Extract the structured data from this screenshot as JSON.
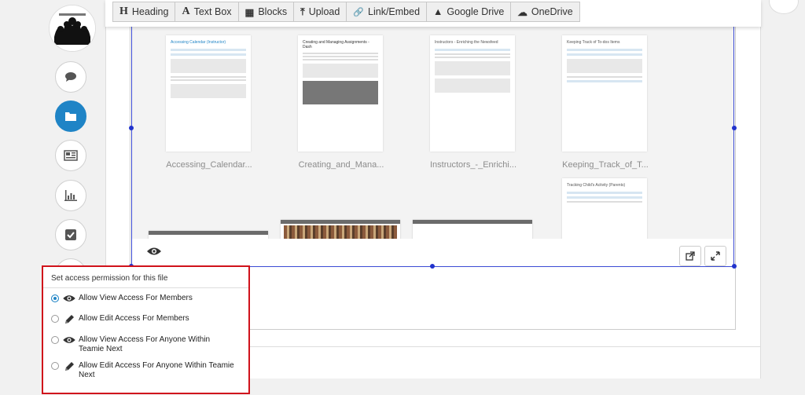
{
  "toolbar": {
    "items": [
      {
        "icon": "H",
        "label": "Heading"
      },
      {
        "icon": "A",
        "label": "Text Box"
      },
      {
        "icon": "▦",
        "label": "Blocks"
      },
      {
        "icon": "⤒",
        "label": "Upload"
      },
      {
        "icon": "🔗",
        "label": "Link/Embed"
      },
      {
        "icon": "▲",
        "label": "Google Drive"
      },
      {
        "icon": "☁",
        "label": "OneDrive"
      }
    ]
  },
  "sidebar": {
    "items": [
      {
        "icon": "chat-icon"
      },
      {
        "icon": "folder-icon",
        "active": true
      },
      {
        "icon": "newspaper-icon"
      },
      {
        "icon": "bar-chart-icon"
      },
      {
        "icon": "checkbox-icon"
      }
    ]
  },
  "files": [
    {
      "title": "Accessing Calendar (Instructor)",
      "name": "Accessing_Calendar..."
    },
    {
      "title": "Creating and Managing Assignments - Dash",
      "name": "Creating_and_Mana..."
    },
    {
      "title": "Instructors - Enriching the Newsfeed",
      "name": "Instructors_-_Enrichi..."
    },
    {
      "title": "Keeping Track of To-dos Items",
      "name": "Keeping_Track_of_T..."
    },
    {
      "title": "Tracking Child's Activity (Parents)",
      "name": ""
    }
  ],
  "permission_popup": {
    "title": "Set access permission for this file",
    "options": [
      {
        "label": "Allow View Access For Members",
        "icon": "eye-icon",
        "selected": true
      },
      {
        "label": "Allow Edit Access For Members",
        "icon": "pencil-icon",
        "selected": false
      },
      {
        "label": "Allow View Access For Anyone Within Teamie Next",
        "icon": "eye-icon",
        "selected": false
      },
      {
        "label": "Allow Edit Access For Anyone Within Teamie Next",
        "icon": "pencil-icon",
        "selected": false
      }
    ]
  }
}
